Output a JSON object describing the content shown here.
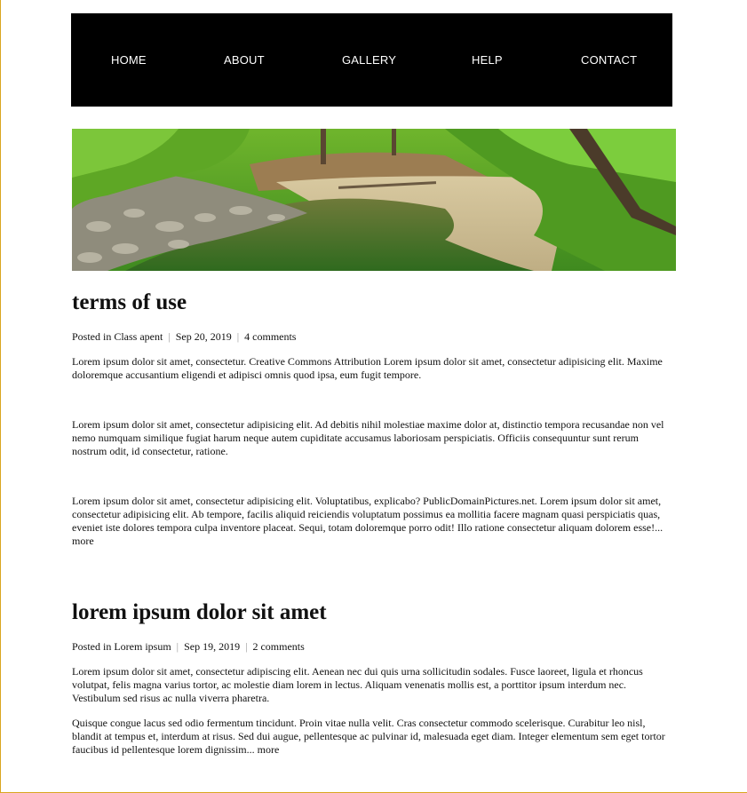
{
  "nav": {
    "items": [
      "HOME",
      "ABOUT",
      "GALLERY",
      "HELP",
      "CONTACT"
    ]
  },
  "banner": {
    "image_alt": "forest creek scene"
  },
  "posts": [
    {
      "title": "terms of use",
      "meta": {
        "prefix": "Posted in",
        "category": "Class apent",
        "date": "Sep 20, 2019",
        "comments": "4 comments"
      },
      "paragraphs": [
        "Lorem ipsum dolor sit amet, consectetur. Creative Commons Attribution Lorem ipsum dolor sit amet, consectetur adipisicing elit. Maxime doloremque accusantium eligendi et adipisci omnis quod ipsa, eum fugit tempore.",
        "Lorem ipsum dolor sit amet, consectetur adipisicing elit. Ad debitis nihil molestiae maxime dolor at, distinctio tempora recusandae non vel nemo numquam similique fugiat harum neque autem cupiditate accusamus laboriosam perspiciatis. Officiis consequuntur sunt rerum nostrum odit, id consectetur, ratione.",
        "Lorem ipsum dolor sit amet, consectetur adipisicing elit. Voluptatibus, explicabo? PublicDomainPictures.net. Lorem ipsum dolor sit amet, consectetur adipisicing elit. Ab tempore, facilis aliquid reiciendis voluptatum possimus ea mollitia facere magnam quasi perspiciatis quas, eveniet iste dolores tempora culpa inventore placeat. Sequi, totam doloremque porro odit! Illo ratione consectetur aliquam dolorem esse!..."
      ],
      "more_label": "more"
    },
    {
      "title": "lorem ipsum dolor sit amet",
      "meta": {
        "prefix": "Posted in",
        "category": "Lorem ipsum",
        "date": "Sep 19, 2019",
        "comments": "2 comments"
      },
      "paragraphs": [
        "Lorem ipsum dolor sit amet, consectetur adipiscing elit. Aenean nec dui quis urna sollicitudin sodales. Fusce laoreet, ligula et rhoncus volutpat, felis magna varius tortor, ac molestie diam lorem in lectus. Aliquam venenatis mollis est, a porttitor ipsum interdum nec. Vestibulum sed risus ac nulla viverra pharetra.",
        "Quisque congue lacus sed odio fermentum tincidunt. Proin vitae nulla velit. Cras consectetur commodo scelerisque. Curabitur leo nisl, blandit at tempus et, interdum at risus. Sed dui augue, pellentesque ac pulvinar id, malesuada eget diam. Integer elementum sem eget tortor faucibus id pellentesque lorem dignissim..."
      ],
      "more_label": "more"
    }
  ],
  "colors": {
    "nav_background": "#000000",
    "nav_text": "#ffffff",
    "frame": "#d9a520",
    "text": "#111111"
  }
}
